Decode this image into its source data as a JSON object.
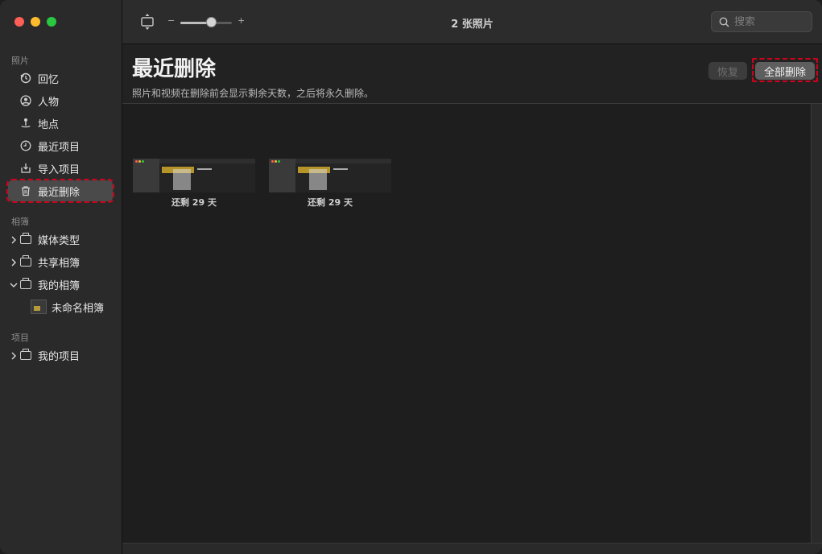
{
  "toolbar": {
    "title": "2 张照片",
    "zoom_minus": "−",
    "zoom_plus": "+",
    "zoom_level": 0.6,
    "search_placeholder": "搜索"
  },
  "sidebar": {
    "sections": {
      "photos": "照片",
      "albums": "相簿",
      "projects": "项目"
    },
    "photo_items": [
      {
        "label": "回忆",
        "icon": "memories-icon"
      },
      {
        "label": "人物",
        "icon": "people-icon"
      },
      {
        "label": "地点",
        "icon": "places-icon"
      },
      {
        "label": "最近项目",
        "icon": "recent-clock-icon"
      },
      {
        "label": "导入项目",
        "icon": "import-icon"
      },
      {
        "label": "最近删除",
        "icon": "trash-icon",
        "selected": true
      }
    ],
    "album_items": [
      {
        "label": "媒体类型",
        "icon": "folder-icon",
        "expanded": false
      },
      {
        "label": "共享相簿",
        "icon": "shared-folder-icon",
        "expanded": false
      },
      {
        "label": "我的相簿",
        "icon": "folder-icon",
        "expanded": true
      }
    ],
    "sub_album": {
      "label": "未命名相簿"
    },
    "project_items": [
      {
        "label": "我的项目",
        "icon": "folder-icon",
        "expanded": false
      }
    ]
  },
  "header": {
    "title": "最近删除",
    "subtitle": "照片和视频在删除前会显示剩余天数，之后将永久删除。",
    "restore_label": "恢复",
    "delete_all_label": "全部删除"
  },
  "photos": [
    {
      "caption": "还剩 29 天"
    },
    {
      "caption": "还剩 29 天"
    }
  ],
  "colors": {
    "highlight": "#d0021b",
    "selected_bg": "#4a4a4a"
  }
}
